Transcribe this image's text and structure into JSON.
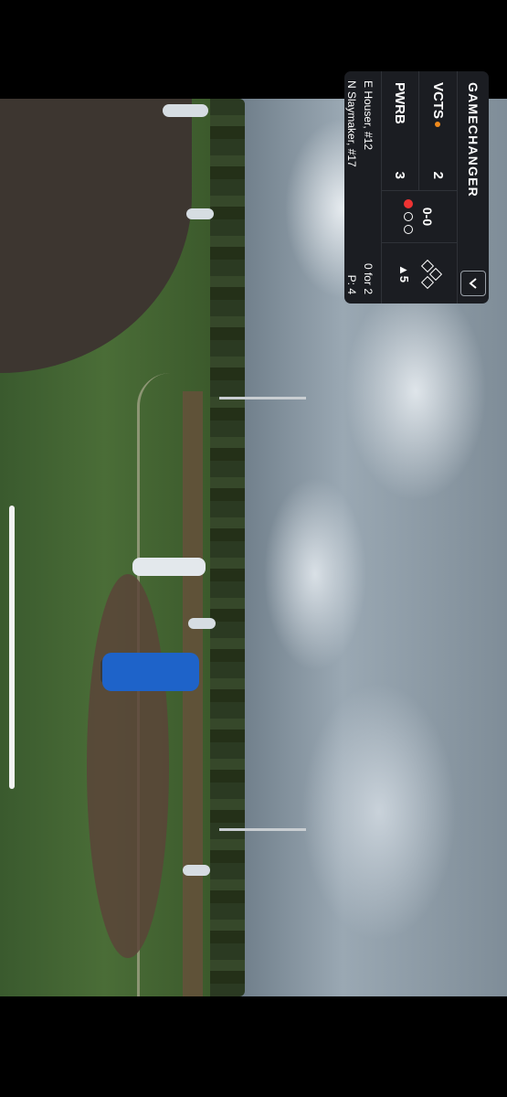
{
  "scoreboard": {
    "brand": "GAMECHANGER",
    "expand_icon": "chevron-down-icon",
    "teams": [
      {
        "abbr": "VCTS",
        "score": "2",
        "batting": true
      },
      {
        "abbr": "PWRB",
        "score": "3",
        "batting": false
      }
    ],
    "count": "0-0",
    "outs": 1,
    "inning": "▲5",
    "batter": {
      "name": "E Houser, #12",
      "stat": "0 for 2"
    },
    "pitcher": {
      "name": "N Slaymaker, #17",
      "stat": "P: 4"
    }
  },
  "colors": {
    "panel": "#1b1d22",
    "accent": "#f08a1c",
    "out": "#e33333"
  }
}
